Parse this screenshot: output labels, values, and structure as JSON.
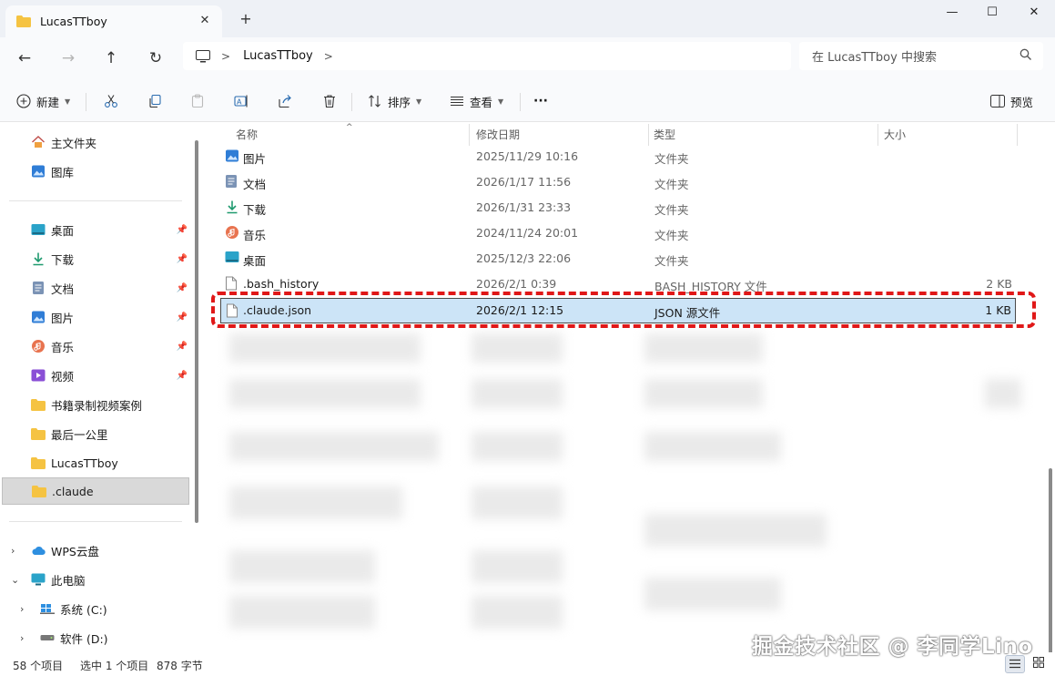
{
  "window": {
    "tab_title": "LucasTTboy",
    "close_tab": "✕",
    "new_tab": "+",
    "minimize": "—",
    "maximize": "☐",
    "close": "✕"
  },
  "nav": {
    "back": "←",
    "forward": "→",
    "up": "↑",
    "refresh": "↻",
    "breadcrumb": "LucasTTboy",
    "breadcrumb_sep": ">",
    "breadcrumb_end": ">",
    "search_placeholder": "在 LucasTTboy 中搜索"
  },
  "toolbar": {
    "new_label": "新建",
    "sort_label": "排序",
    "view_label": "查看",
    "more_label": "···",
    "preview_label": "预览"
  },
  "sidebar": {
    "home": "主文件夹",
    "gallery": "图库",
    "desktop": "桌面",
    "downloads": "下载",
    "documents": "文档",
    "pictures": "图片",
    "music": "音乐",
    "videos": "视频",
    "folder1": "书籍录制视频案例",
    "folder2": "最后一公里",
    "folder3": "LucasTTboy",
    "folder4": ".claude",
    "wps": "WPS云盘",
    "thispc": "此电脑",
    "drive_c": "系统 (C:)",
    "drive_d": "软件 (D:)"
  },
  "columns": {
    "name": "名称",
    "date": "修改日期",
    "type": "类型",
    "size": "大小"
  },
  "files": [
    {
      "name": "图片",
      "date": "2025/11/29 10:16",
      "type": "文件夹",
      "size": ""
    },
    {
      "name": "文档",
      "date": "2026/1/17 11:56",
      "type": "文件夹",
      "size": ""
    },
    {
      "name": "下载",
      "date": "2026/1/31 23:33",
      "type": "文件夹",
      "size": ""
    },
    {
      "name": "音乐",
      "date": "2024/11/24 20:01",
      "type": "文件夹",
      "size": ""
    },
    {
      "name": "桌面",
      "date": "2025/12/3 22:06",
      "type": "文件夹",
      "size": ""
    },
    {
      "name": ".bash_history",
      "date": "2026/2/1 0:39",
      "type": "BASH_HISTORY 文件",
      "size": "2 KB"
    },
    {
      "name": ".claude.json",
      "date": "2026/2/1 12:15",
      "type": "JSON 源文件",
      "size": "1 KB"
    }
  ],
  "status": {
    "count": "58 个项目",
    "selection": "选中 1 个项目",
    "selection_size": "878 字节"
  },
  "watermark": "掘金技术社区 @ 李同学Lino",
  "colors": {
    "selected_row": "#cce4f7",
    "highlight": "#e01818",
    "folder": "#f5c342"
  }
}
